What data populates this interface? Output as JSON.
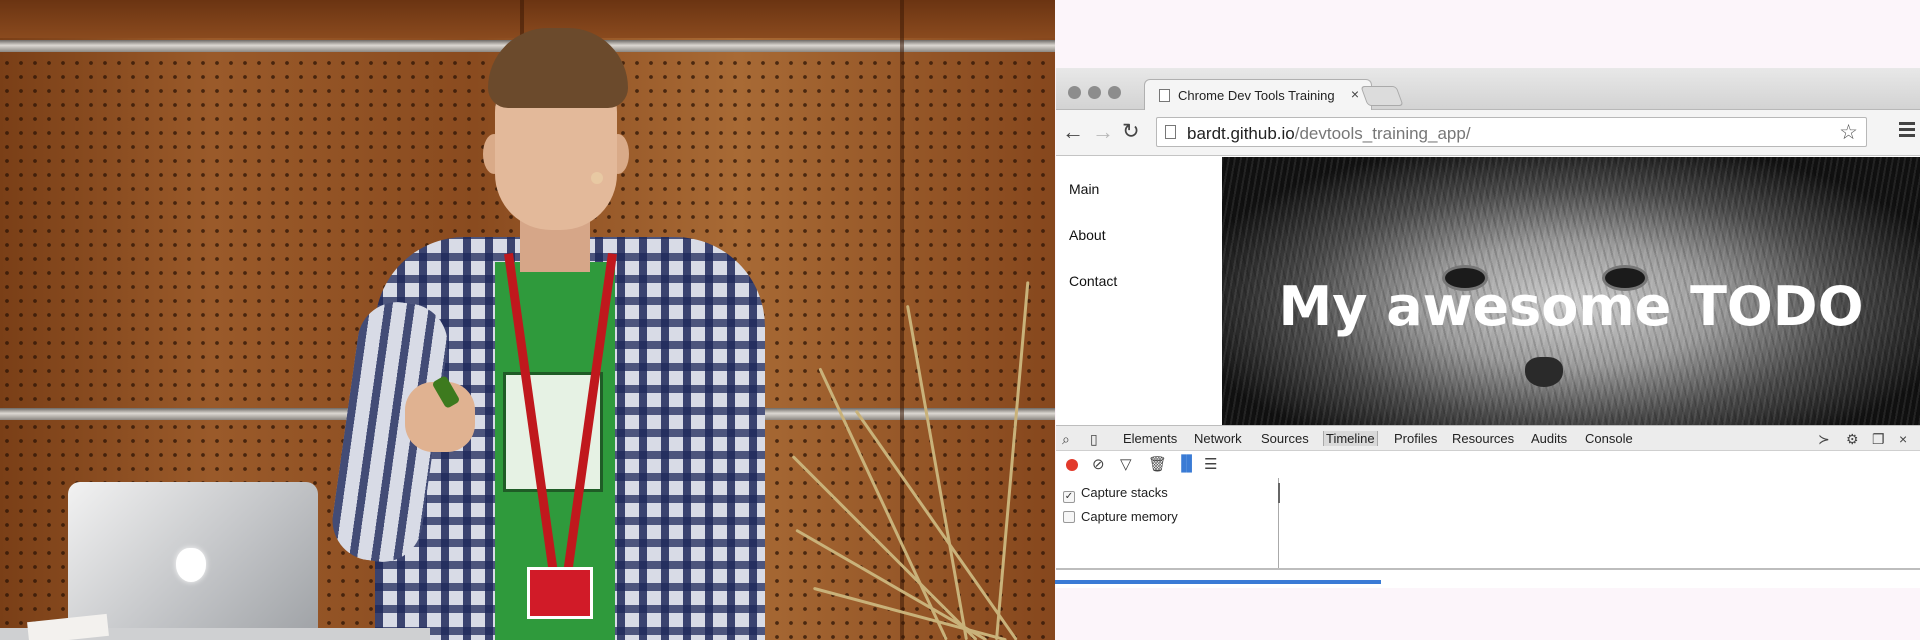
{
  "browser": {
    "tab_title": "Chrome Dev Tools Training",
    "tab_close": "×",
    "url_host": "bardt.github.io",
    "url_path": "/devtools_training_app/"
  },
  "site": {
    "nav": [
      "Main",
      "About",
      "Contact"
    ],
    "hero_title": "My awesome TODO"
  },
  "devtools": {
    "tabs": [
      "Elements",
      "Network",
      "Sources",
      "Timeline",
      "Profiles",
      "Resources",
      "Audits",
      "Console"
    ],
    "active_tab": "Timeline",
    "options": [
      {
        "label": "Capture stacks",
        "checked": true
      },
      {
        "label": "Capture memory",
        "checked": false
      }
    ]
  },
  "colors": {
    "record": "#e23a2c",
    "progress": "#3a7bd5",
    "slide_bg": "#fcf5fa"
  },
  "icons": [
    "back-icon",
    "forward-icon",
    "reload-icon",
    "star-icon",
    "menu-icon",
    "search-icon",
    "device-icon",
    "record-icon",
    "clear-icon",
    "filter-icon",
    "trash-icon",
    "flame-chart-icon",
    "waterfall-icon",
    "drawer-icon",
    "settings-icon",
    "dock-icon",
    "close-icon"
  ]
}
